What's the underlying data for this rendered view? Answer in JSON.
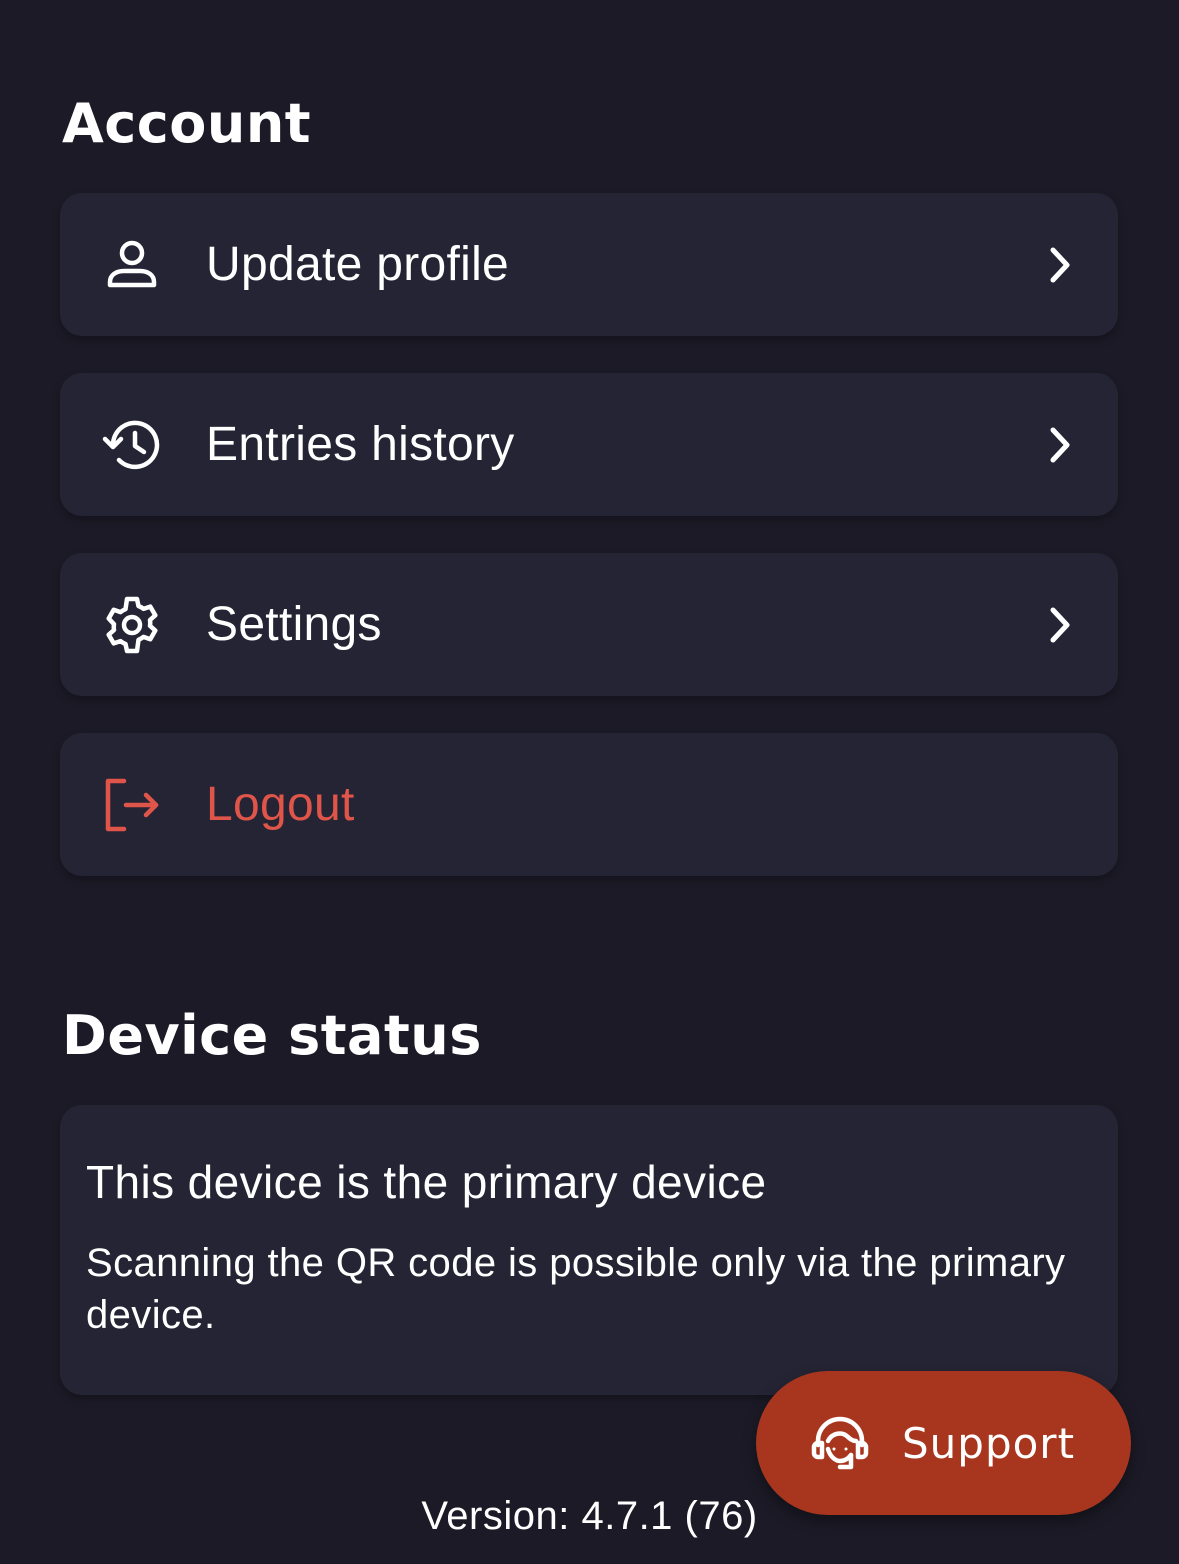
{
  "account": {
    "title": "Account",
    "items": [
      {
        "label": "Update profile",
        "icon": "user-icon"
      },
      {
        "label": "Entries history",
        "icon": "history-icon"
      },
      {
        "label": "Settings",
        "icon": "gear-icon"
      },
      {
        "label": "Logout",
        "icon": "logout-icon"
      }
    ]
  },
  "device_status": {
    "title": "Device status",
    "heading": "This device is the primary device",
    "description": "Scanning the QR code is possible only via the primary device."
  },
  "support": {
    "label": "Support",
    "icon": "headset-agent-icon"
  },
  "version": "Version: 4.7.1 (76)",
  "colors": {
    "background": "#1b1a26",
    "card": "#252434",
    "danger": "#e0554a",
    "support": "#a8361e"
  }
}
